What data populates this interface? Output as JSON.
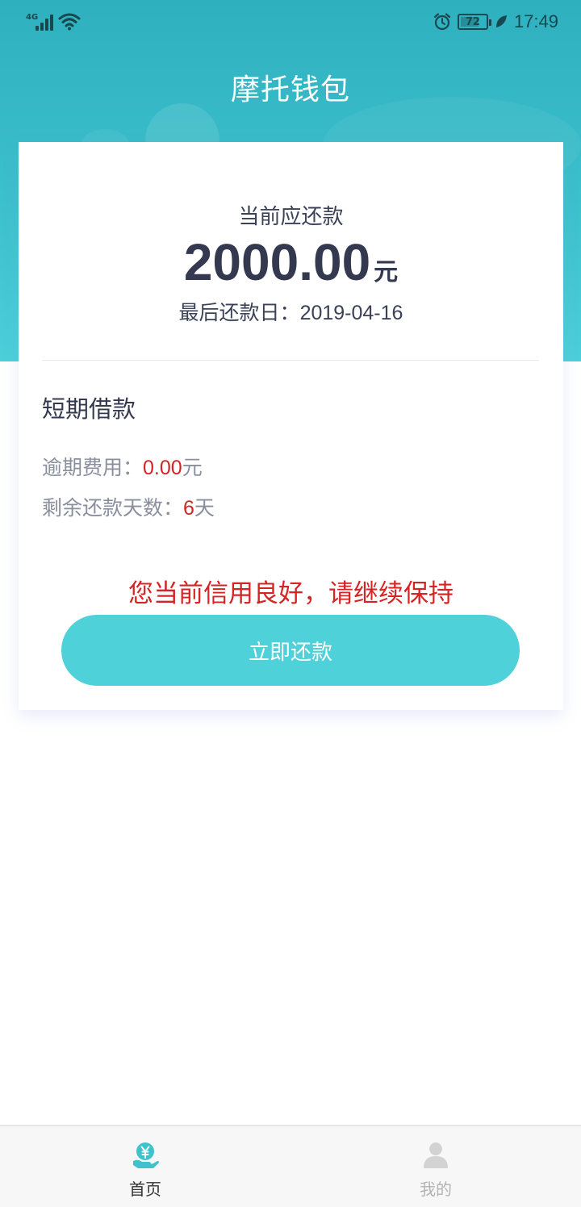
{
  "status_bar": {
    "network": "4G",
    "battery": "72",
    "time": "17:49"
  },
  "header": {
    "title": "摩托钱包"
  },
  "repayment": {
    "label": "当前应还款",
    "amount": "2000.00",
    "unit": "元",
    "due_label": "最后还款日：",
    "due_date": "2019-04-16"
  },
  "loan": {
    "type": "短期借款",
    "overdue_label": "逾期费用：",
    "overdue_value": "0.00",
    "overdue_unit": "元",
    "days_label": "剩余还款天数：",
    "days_value": "6",
    "days_unit": "天"
  },
  "credit_message": "您当前信用良好，请继续保持",
  "pay_button": "立即还款",
  "tabs": [
    {
      "label": "首页",
      "icon": "yen-hand-icon",
      "active": true
    },
    {
      "label": "我的",
      "icon": "user-icon",
      "active": false
    }
  ],
  "colors": {
    "accent": "#4fd1d9",
    "header": "#2fb0bf",
    "alert_red": "#d42424"
  }
}
